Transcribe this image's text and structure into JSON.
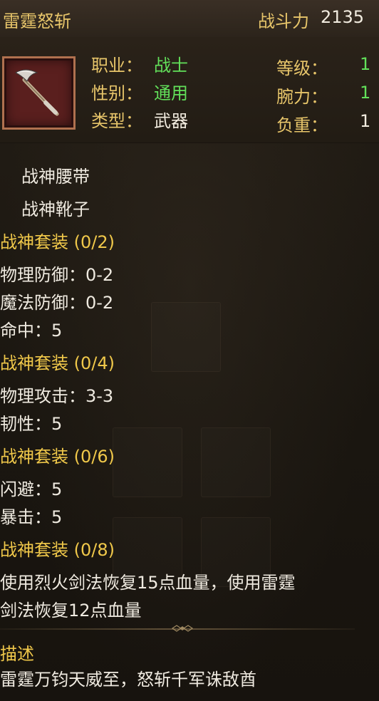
{
  "item": {
    "name": "雷霆怒斩",
    "power_label": "战斗力",
    "power_value": "2135",
    "icon": "axe-icon"
  },
  "attributes": {
    "profession_label": "职业：",
    "profession_value": "战士",
    "gender_label": "性别：",
    "gender_value": "通用",
    "type_label": "类型：",
    "type_value": "武器",
    "level_label": "等级：",
    "level_value": "1",
    "strength_label": "腕力：",
    "strength_value": "1",
    "weight_label": "负重：",
    "weight_value": "1"
  },
  "set_pieces": [
    "战神腰带",
    "战神靴子"
  ],
  "set_bonuses": [
    {
      "title": "战神套装 (0/2)",
      "lines": [
        "物理防御：0-2",
        "魔法防御：0-2",
        "命中：5"
      ]
    },
    {
      "title": "战神套装 (0/4)",
      "lines": [
        "物理攻击：3-3",
        "韧性：5"
      ]
    },
    {
      "title": "战神套装 (0/6)",
      "lines": [
        "闪避：5",
        "暴击：5"
      ]
    },
    {
      "title": "战神套装 (0/8)",
      "lines": [
        "使用烈火剑法恢复15点血量，使用雷霆",
        "剑法恢复12点血量"
      ]
    }
  ],
  "description": {
    "title": "描述",
    "text": "雷霆万钧天威至，怒斩千军诛敌酋"
  },
  "colors": {
    "gold": "#f0c84a",
    "green": "#62e05a",
    "frame": "#b0714f"
  }
}
